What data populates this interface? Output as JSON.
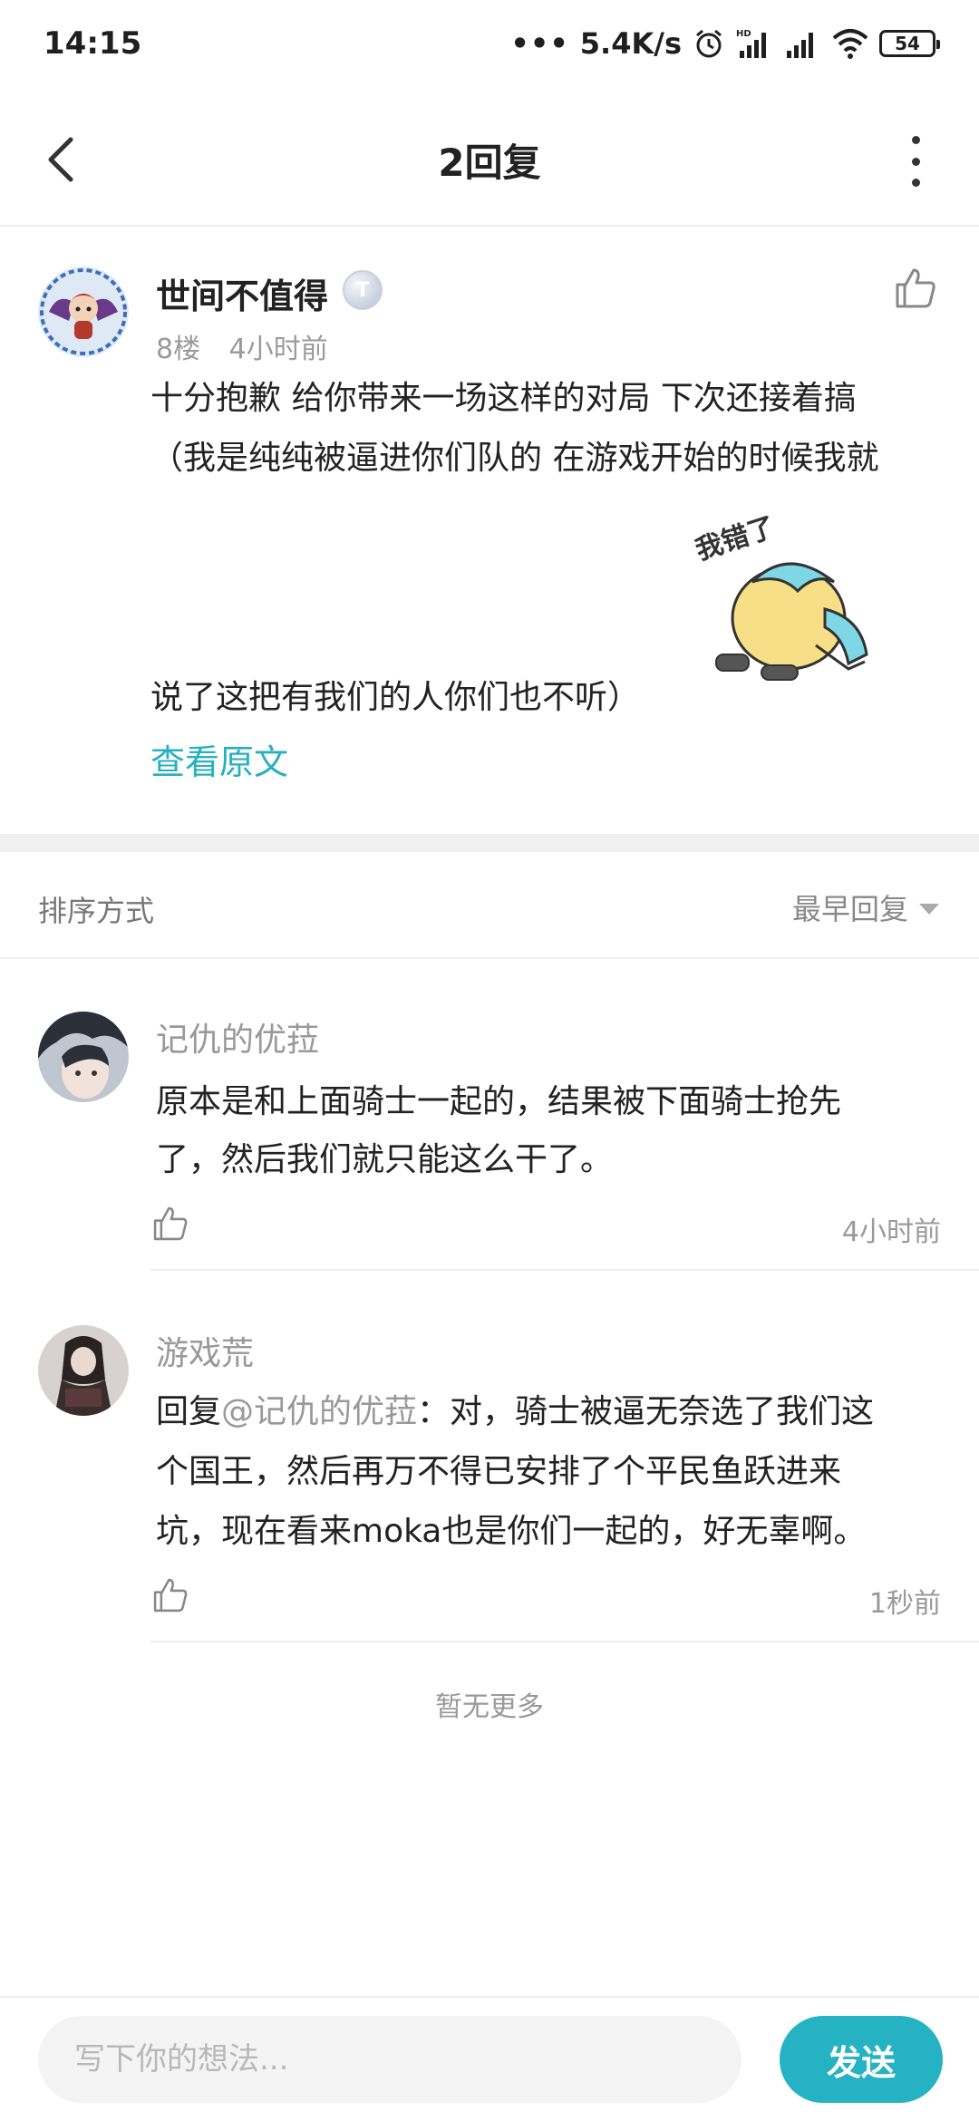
{
  "status_bar": {
    "time": "14:15",
    "dots": "•••",
    "network_speed": "5.4K/s",
    "battery": "54",
    "icons": [
      "alarm-icon",
      "hd-signal-icon",
      "signal-icon",
      "wifi-icon",
      "battery-icon"
    ]
  },
  "header": {
    "title": "2回复",
    "back_icon": "chevron-left-icon",
    "more_icon": "more-vertical-icon"
  },
  "post": {
    "author": "世间不值得",
    "badge": "T",
    "floor": "8楼",
    "time": "4小时前",
    "lines": [
      "十分抱歉 给你带来一场这样的对局 下次还接着搞",
      "（我是纯纯被逼进你们队的 在游戏开始的时候我就",
      "说了这把有我们的人你们也不听）"
    ],
    "sticker_text": "我错了",
    "view_original": "查看原文"
  },
  "sort": {
    "label": "排序方式",
    "selected": "最早回复"
  },
  "replies": [
    {
      "name": "记仇的优菈",
      "lines": [
        "原本是和上面骑士一起的，结果被下面骑士抢先",
        "了，然后我们就只能这么干了。"
      ],
      "time": "4小时前"
    },
    {
      "name": "游戏荒",
      "reply_prefix": "回复",
      "mention": "@记仇的优菈",
      "line1_rest": "：对，骑士被逼无奈选了我们这",
      "lines": [
        "个国王，然后再万不得已安排了个平民鱼跃进来",
        "坑，现在看来moka也是你们一起的，好无辜啊。"
      ],
      "time": "1秒前"
    }
  ],
  "footer_note": "暂无更多",
  "input": {
    "placeholder": "写下你的想法...",
    "send_label": "发送"
  },
  "colors": {
    "accent": "#25b2c2",
    "link": "#26b0c0",
    "muted_text": "#999999"
  }
}
